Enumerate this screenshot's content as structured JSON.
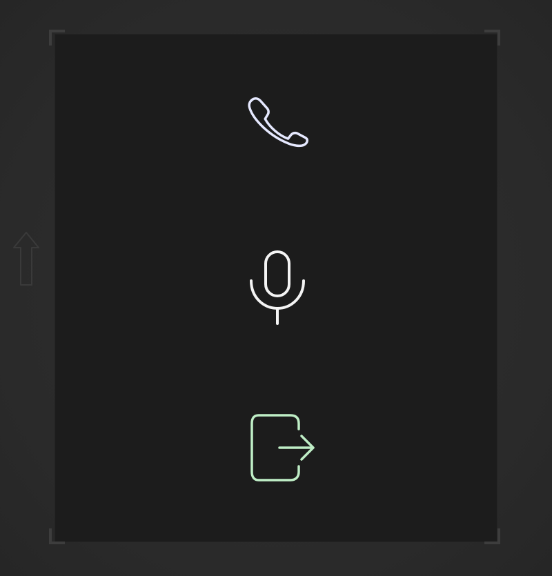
{
  "colors": {
    "background": "#2c2c2c",
    "panel": "#1c1c1c",
    "call_icon": "#e6e9ff",
    "mic_icon": "#f4f4f4",
    "exit_icon": "#bfeec6",
    "side_arrow": "#3a3a3a",
    "corner_marks": "#3d3d3d"
  },
  "controls": [
    {
      "id": "call",
      "icon": "phone-icon"
    },
    {
      "id": "microphone",
      "icon": "microphone-icon"
    },
    {
      "id": "exit",
      "icon": "exit-icon"
    }
  ],
  "side_control": {
    "icon": "arrow-up-icon"
  }
}
